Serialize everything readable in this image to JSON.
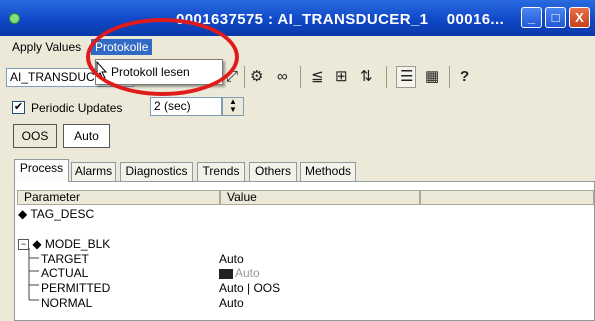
{
  "window": {
    "title": "0001637575 : AI_TRANSDUCER_1",
    "title_suffix": "00016...",
    "controls": {
      "minimize": "_",
      "maximize": "□",
      "close": "X"
    }
  },
  "menubar": {
    "items": [
      {
        "label": "Apply Values"
      },
      {
        "label": "Protokolle",
        "active": true
      }
    ]
  },
  "dropdown": {
    "items": [
      {
        "label": "Protokoll lesen"
      }
    ]
  },
  "toolbar": {
    "combo_value": "AI_TRANSDUCER",
    "icons": [
      "settings-icon",
      "glasses-icon",
      "compare-icon",
      "chart-icon",
      "arrows-icon",
      "list-icon",
      "grid-icon",
      "help-icon"
    ],
    "help_glyph": "?"
  },
  "periodic": {
    "label": "Periodic Updates",
    "checked": true,
    "check_glyph": "✔",
    "interval": "2 (sec)"
  },
  "mode_buttons": {
    "oos": "OOS",
    "auto": "Auto"
  },
  "tabs": [
    {
      "label": "Process",
      "active": true
    },
    {
      "label": "Alarms"
    },
    {
      "label": "Diagnostics"
    },
    {
      "label": "Trends"
    },
    {
      "label": "Others"
    },
    {
      "label": "Methods"
    }
  ],
  "table": {
    "columns": [
      "Parameter",
      "Value"
    ],
    "rows": [
      {
        "parameter": "TAG_DESC",
        "value": ""
      },
      {
        "parameter": "MODE_BLK",
        "value": ""
      },
      {
        "parameter": "TARGET",
        "value": "Auto"
      },
      {
        "parameter": "ACTUAL",
        "value": "Auto"
      },
      {
        "parameter": "PERMITTED",
        "value": "Auto | OOS"
      },
      {
        "parameter": "NORMAL",
        "value": "Auto"
      }
    ]
  },
  "colors": {
    "title_bar": "#1048c8",
    "menu_highlight": "#316ac5",
    "annotation_ring": "#e01b1b"
  }
}
